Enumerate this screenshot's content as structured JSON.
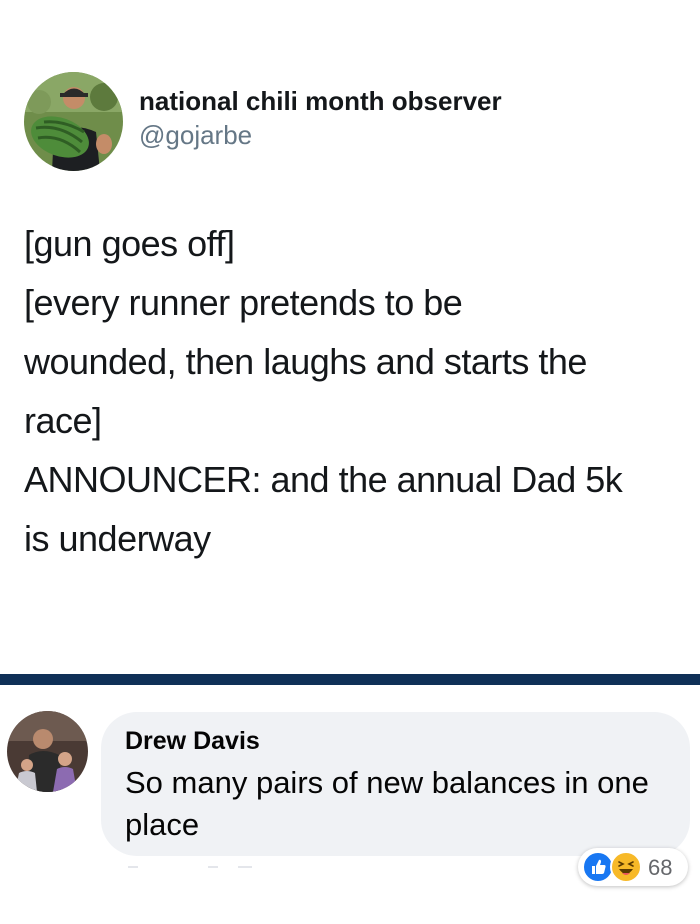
{
  "tweet": {
    "display_name": "national chili month observer",
    "handle": "@gojarbe",
    "lines": [
      "[gun goes off]",
      "[every runner pretends to be",
      "wounded, then laughs and starts the",
      "race]",
      "ANNOUNCER: and the annual Dad 5k",
      "is underway"
    ],
    "avatar_icon": "profile-photo-man-holding-watermelon"
  },
  "comment": {
    "author": "Drew Davis",
    "text": "So many pairs of new balances in one place",
    "avatar_icon": "profile-photo-family",
    "reactions": {
      "icons": [
        "like-icon",
        "haha-icon"
      ],
      "count": "68"
    }
  },
  "colors": {
    "divider": "#0f3057",
    "bubble": "#f0f2f5",
    "like": "#1877f2",
    "haha": "#f7b928",
    "handle": "#657786"
  }
}
